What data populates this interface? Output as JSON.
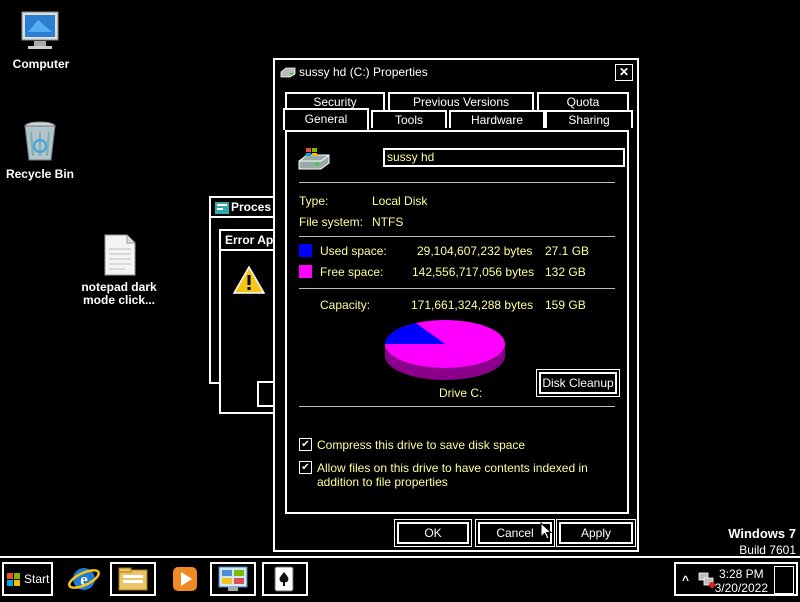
{
  "desktop": {
    "icons": [
      {
        "label": "Computer"
      },
      {
        "label": "Recycle Bin"
      },
      {
        "label": "notepad dark mode click..."
      }
    ]
  },
  "background_windows": {
    "process_title": "Proces",
    "error_title": "Error App"
  },
  "dialog": {
    "title": "sussy hd (C:) Properties",
    "close_glyph": "✕",
    "tabs_back": [
      "Security",
      "Previous Versions",
      "Quota"
    ],
    "tabs_front": [
      "General",
      "Tools",
      "Hardware",
      "Sharing"
    ],
    "active_tab": "General",
    "drive_name": "sussy hd",
    "type_label": "Type:",
    "type_value": "Local Disk",
    "fs_label": "File system:",
    "fs_value": "NTFS",
    "used_label": "Used space:",
    "used_bytes": "29,104,607,232 bytes",
    "used_gb": "27.1 GB",
    "free_label": "Free space:",
    "free_bytes": "142,556,717,056 bytes",
    "free_gb": "132 GB",
    "capacity_label": "Capacity:",
    "capacity_bytes": "171,661,324,288 bytes",
    "capacity_gb": "159 GB",
    "drive_caption": "Drive C:",
    "disk_cleanup": "Disk Cleanup",
    "compress_label": "Compress this drive to save disk space",
    "index_label": "Allow files on this drive to have contents indexed in addition to file properties",
    "compress_checked": true,
    "index_checked": true,
    "used_fraction": 0.1695,
    "used_color": "#0000ff",
    "free_color": "#ff00ff",
    "ok": "OK",
    "cancel": "Cancel",
    "apply": "Apply"
  },
  "watermark": {
    "line1": "Windows 7",
    "line2": "Build 7601"
  },
  "taskbar": {
    "start_label": "Start",
    "pinned": [
      "internet-explorer-icon",
      "file-explorer-icon",
      "media-player-icon",
      "control-panel-icon",
      "solitaire-icon"
    ],
    "tray_chevron": "^",
    "time": "3:28 PM",
    "date": "3/20/2022"
  }
}
